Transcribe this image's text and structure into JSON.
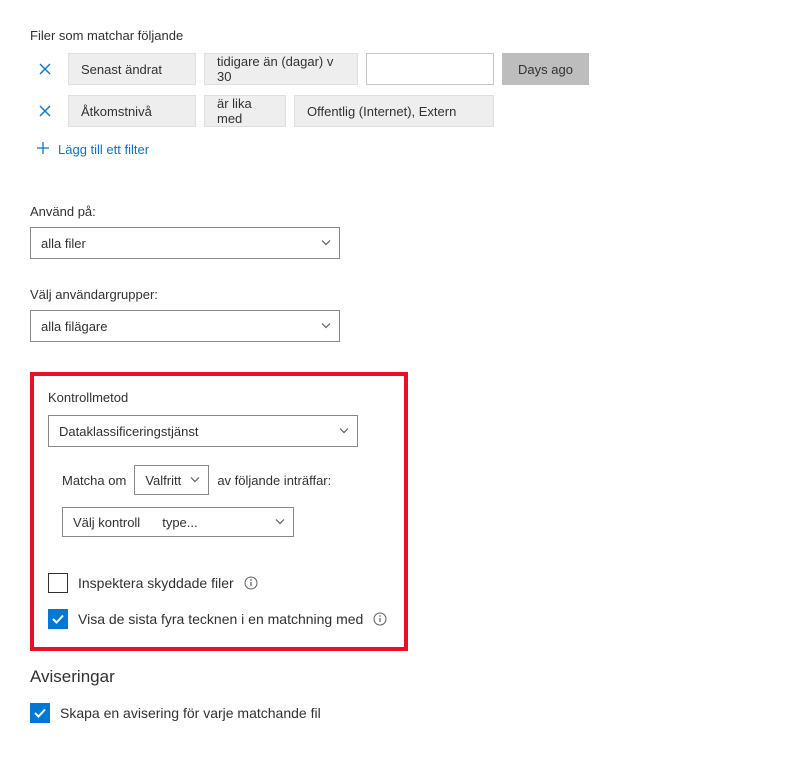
{
  "header": {
    "matchingLabel": "Filer som matchar följande"
  },
  "filters": {
    "row1": {
      "field": "Senast ändrat",
      "operator": "tidigare än (dagar) v 30",
      "value": "",
      "unitButton": "Days ago"
    },
    "row2": {
      "field": "Åtkomstnivå",
      "operator": "är lika med",
      "value": "Offentlig (Internet), Extern"
    },
    "addLabel": "Lägg till ett filter"
  },
  "applyTo": {
    "label": "Använd på:",
    "value": "alla filer"
  },
  "userGroups": {
    "label": "Välj användargrupper:",
    "value": "alla filägare"
  },
  "inspection": {
    "methodLabel": "Kontrollmetod",
    "methodValue": "Dataklassificeringstjänst",
    "matchIfLabelLeft": "Matcha om",
    "matchIfValue": "Valfritt",
    "matchIfLabelRight": "av följande inträffar:",
    "chooseControlLeft": "Välj kontroll",
    "chooseControlRight": "type...",
    "cbInspectLabel": "Inspektera skyddade filer",
    "cbLastFourLabel": "Visa de sista fyra tecknen i en matchning med"
  },
  "alerts": {
    "heading": "Aviseringar",
    "createAlertLabel": "Skapa en avisering för varje matchande fil"
  }
}
